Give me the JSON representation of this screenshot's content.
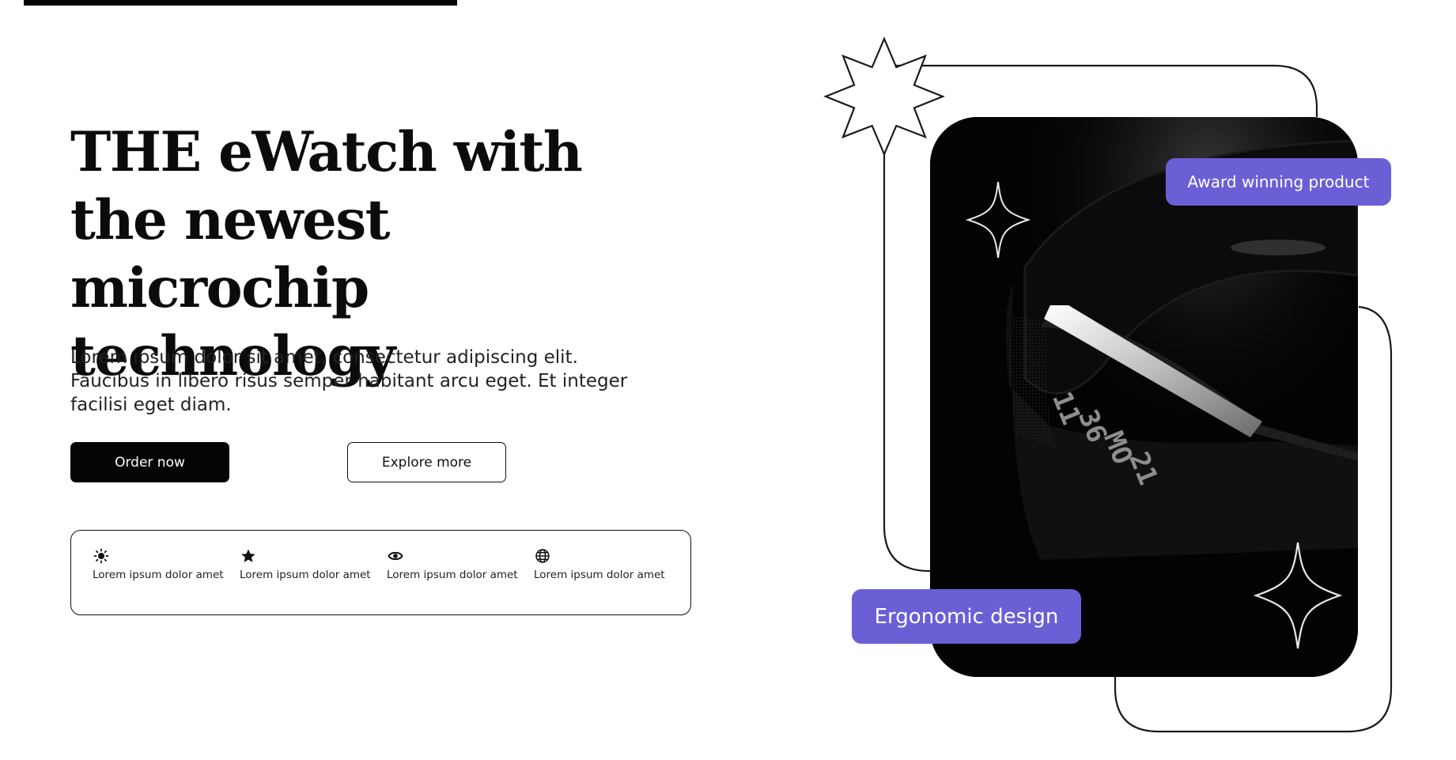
{
  "hero": {
    "title": "THE eWatch with the newest microchip technology",
    "description": "Lorem ipsum dolor sit amet, consectetur adipiscing elit. Faucibus in libero risus semper habitant arcu eget. Et integer facilisi eget diam."
  },
  "actions": {
    "order_label": "Order now",
    "explore_label": "Explore more"
  },
  "features": [
    {
      "icon": "sun-icon",
      "label": "Lorem ipsum dolor amet"
    },
    {
      "icon": "star-icon",
      "label": "Lorem ipsum dolor amet"
    },
    {
      "icon": "eye-icon",
      "label": "Lorem ipsum dolor amet"
    },
    {
      "icon": "globe-icon",
      "label": "Lorem ipsum dolor amet"
    }
  ],
  "showcase": {
    "watch_display": [
      "11",
      "36",
      "MO",
      "21"
    ],
    "badge_award": "Award winning product",
    "badge_ergonomic": "Ergonomic design"
  },
  "colors": {
    "accent": "#6b5fd6",
    "dark": "#050505",
    "background": "#ffffff"
  }
}
